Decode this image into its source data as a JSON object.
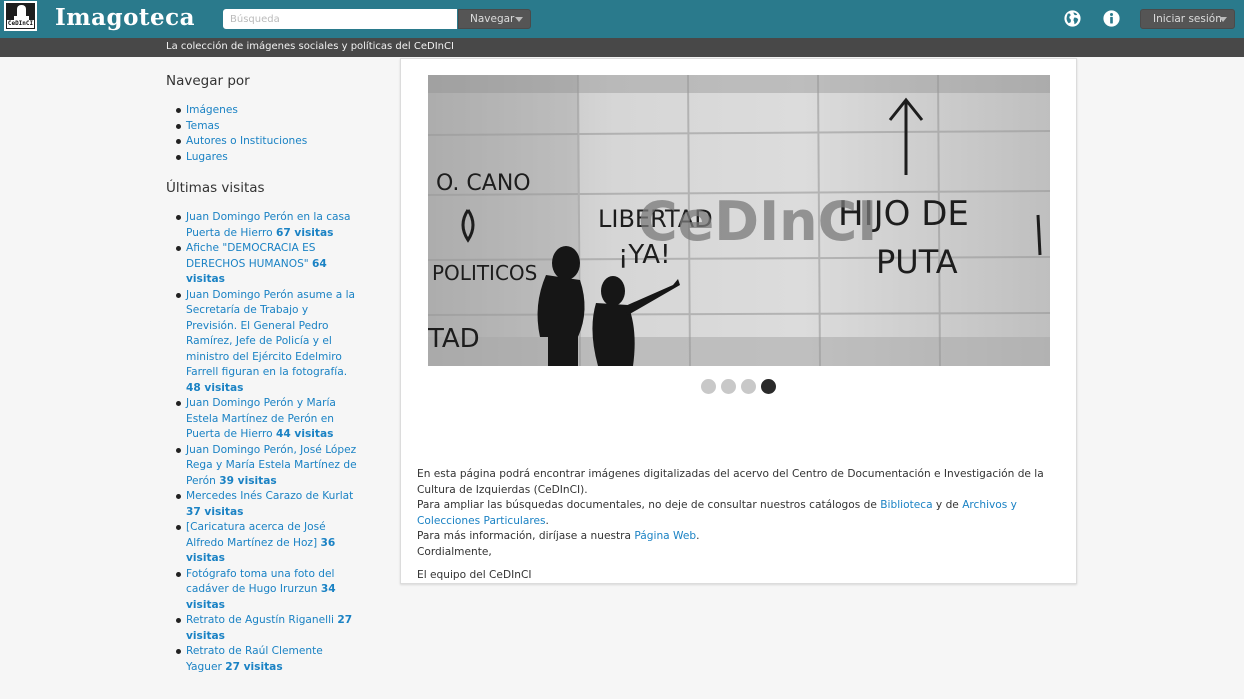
{
  "header": {
    "logo_text": "CeDInCI",
    "site_name": "Imagoteca",
    "search_placeholder": "Búsqueda",
    "browse_label": "Navegar",
    "globe_icon": "globe-icon",
    "info_icon": "info-icon",
    "login_label": "Iniciar sesión",
    "bar_color": "#2a7a8c"
  },
  "subtitle": "La colección de imágenes sociales y políticas del CeDInCI",
  "sidebar": {
    "browse_heading": "Navegar por",
    "browse_items": [
      "Imágenes",
      "Temas",
      "Autores o Instituciones",
      "Lugares"
    ],
    "visits_heading": "Últimas visitas",
    "visits": [
      {
        "title": "Juan Domingo Perón en la casa Puerta de Hierro",
        "count": "67 visitas"
      },
      {
        "title": "Afiche \"DEMOCRACIA ES DERECHOS HUMANOS\"",
        "count": "64 visitas"
      },
      {
        "title": "Juan Domingo Perón asume a la Secretaría de Trabajo y Previsión. El General Pedro Ramírez, Jefe de Policía y el ministro del Ejército Edelmiro Farrell figuran en la fotografía.",
        "count": "48 visitas"
      },
      {
        "title": "Juan Domingo Perón y María Estela Martínez de Perón en Puerta de Hierro",
        "count": "44 visitas"
      },
      {
        "title": "Juan Domingo Perón, José López Rega y María Estela Martínez de Perón",
        "count": "39 visitas"
      },
      {
        "title": "Mercedes Inés Carazo de Kurlat",
        "count": "37 visitas"
      },
      {
        "title": "[Caricatura acerca de José Alfredo Martínez de Hoz]",
        "count": "36 visitas"
      },
      {
        "title": "Fotógrafo toma una foto del cadáver de Hugo Irurzun",
        "count": "34 visitas"
      },
      {
        "title": "Retrato de Agustín Riganelli",
        "count": "27 visitas"
      },
      {
        "title": "Retrato de Raúl Clemente Yaguer",
        "count": "27 visitas"
      }
    ]
  },
  "slider": {
    "graffiti": [
      "O. CANO",
      "LIBERTAD",
      "¡YA!",
      "HIJO DE",
      "PUTA",
      "POLITICOS",
      "TAD"
    ],
    "watermark": "CeDInCI",
    "slide_count": 4,
    "active_slide": 4
  },
  "intro": {
    "p1": "En esta página podrá encontrar imágenes digitalizadas del acervo del Centro de Documentación e Investigación de la Cultura de Izquierdas (CeDInCI).",
    "p2_before": "Para ampliar las búsquedas documentales, no deje de consultar nuestros catálogos de ",
    "p2_link1": "Biblioteca",
    "p2_middle": " y de ",
    "p2_link2": "Archivos y Colecciones Particulares",
    "p2_after": ".",
    "p3_before": "Para más información, diríjase a nuestra ",
    "p3_link": "Página Web",
    "p3_after": ".",
    "p4": "Cordialmente,",
    "p5": "El equipo del CeDInCI",
    "link_color": "#1a82c4"
  }
}
